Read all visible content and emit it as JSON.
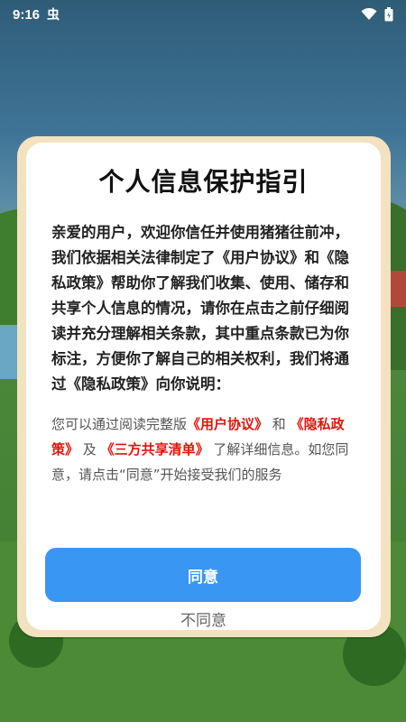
{
  "status_bar": {
    "time": "9:16",
    "app_indicator": "虫",
    "icons": [
      "wifi-icon",
      "battery-icon"
    ]
  },
  "dialog": {
    "title": "个人信息保护指引",
    "body_text": "亲爱的用户，欢迎你信任并使用猪猪往前冲，我们依据相关法律制定了《用户协议》和《隐私政策》帮助你了解我们收集、使用、储存和共享个人信息的情况，请你在点击之前仔细阅读并充分理解相关条款，其中重点条款已为你标注，方便你了解自己的相关权利，我们将通过《隐私政策》向你说明：",
    "note": {
      "prefix": "您可以通过阅读完整版",
      "link_user_agreement": "《用户协议》",
      "and_text": " 和 ",
      "link_privacy_policy": "《隐私政策》",
      "and2_text": " 及 ",
      "link_third_party": "《三方共享清单》",
      "suffix": " 了解详细信息。如您同意，请点击“同意”开始接受我们的服务"
    },
    "agree_label": "同意",
    "disagree_label": "不同意"
  },
  "colors": {
    "accent_button": "#3a96f3",
    "link_red": "#e0150c",
    "dialog_frame": "#f3e2c0"
  }
}
